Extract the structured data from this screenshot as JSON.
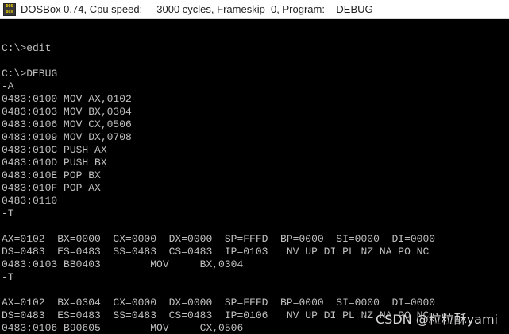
{
  "window": {
    "title": "DOSBox 0.74, Cpu speed:     3000 cycles, Frameskip  0, Program:    DEBUG",
    "icon": "dosbox-icon",
    "icon_text": [
      "DOS",
      "BOX"
    ]
  },
  "console": {
    "lines": [
      "",
      "C:\\>edit",
      "",
      "C:\\>DEBUG",
      "-A",
      "0483:0100 MOV AX,0102",
      "0483:0103 MOV BX,0304",
      "0483:0106 MOV CX,0506",
      "0483:0109 MOV DX,0708",
      "0483:010C PUSH AX",
      "0483:010D PUSH BX",
      "0483:010E POP BX",
      "0483:010F POP AX",
      "0483:0110",
      "-T",
      "",
      "AX=0102  BX=0000  CX=0000  DX=0000  SP=FFFD  BP=0000  SI=0000  DI=0000",
      "DS=0483  ES=0483  SS=0483  CS=0483  IP=0103   NV UP DI PL NZ NA PO NC",
      "0483:0103 BB0403        MOV     BX,0304",
      "-T",
      "",
      "AX=0102  BX=0304  CX=0000  DX=0000  SP=FFFD  BP=0000  SI=0000  DI=0000",
      "DS=0483  ES=0483  SS=0483  CS=0483  IP=0106   NV UP DI PL NZ NA PO NC",
      "0483:0106 B90605        MOV     CX,0506"
    ]
  },
  "watermark": "CSDN @粒粒酥yami"
}
